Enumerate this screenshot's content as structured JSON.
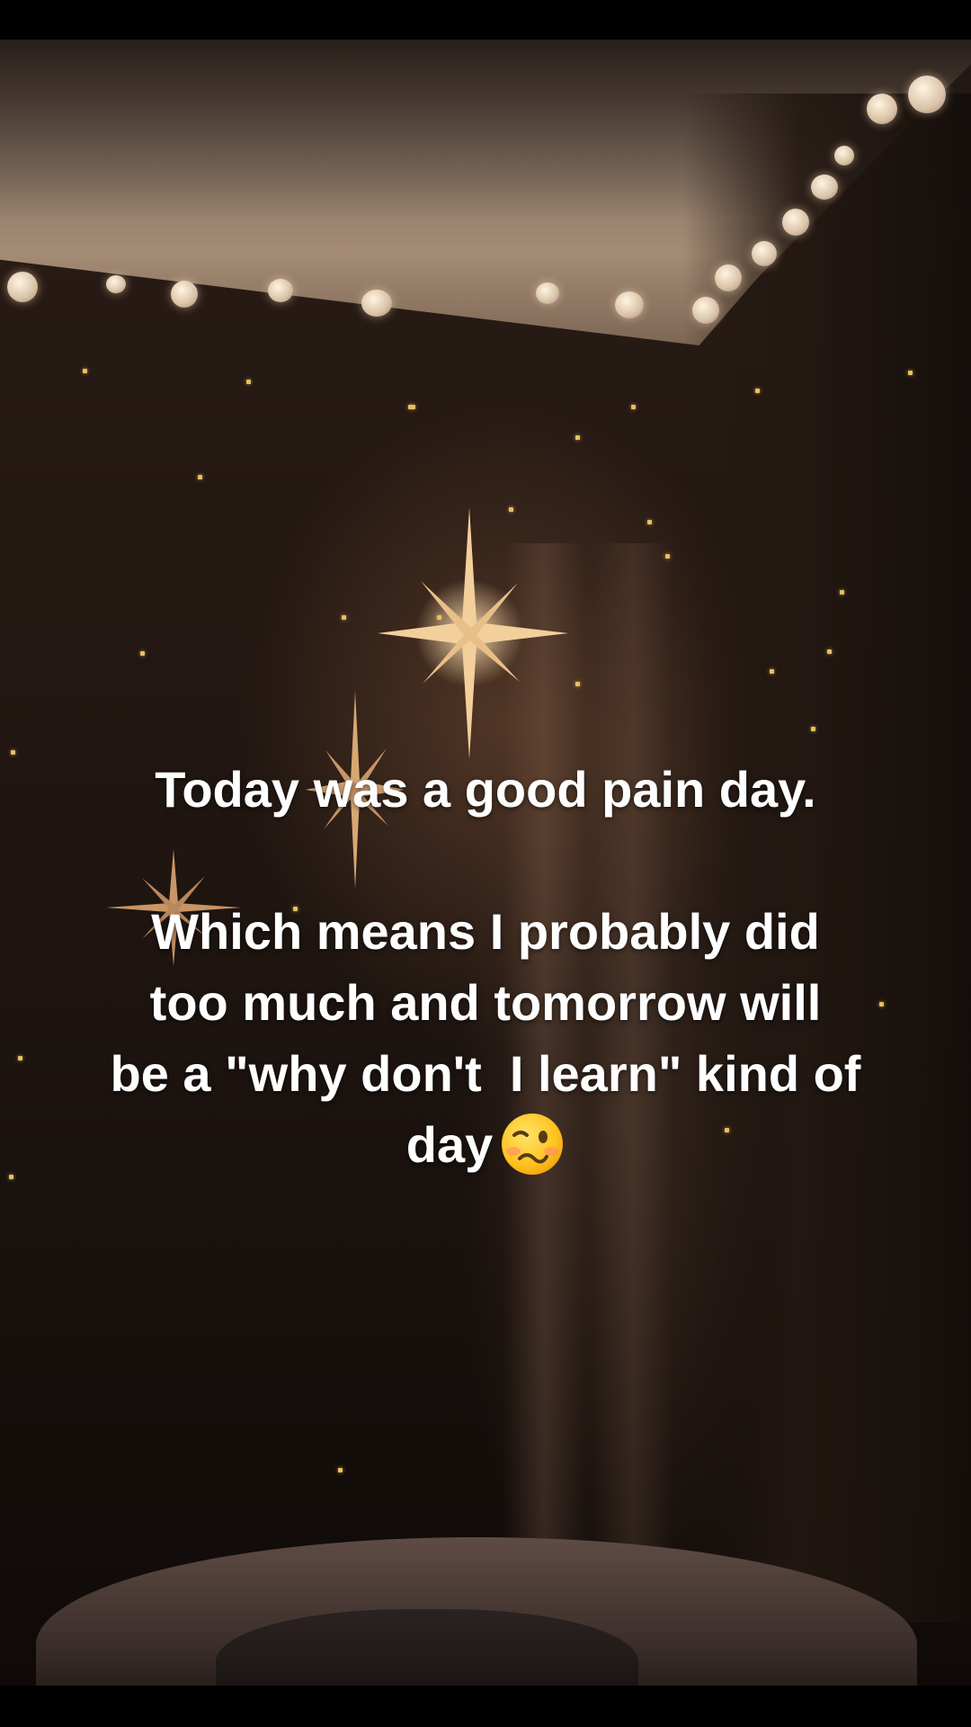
{
  "caption": {
    "line1": "Today was a good pain day.",
    "line2": "Which means I probably did",
    "line3": "too much and tomorrow will",
    "line4": "be a \"why don't  I learn\" kind of",
    "line5": "day"
  },
  "emoji": {
    "icon": "woozy-face-emoji"
  },
  "colors": {
    "text": "#ffffff",
    "star_glow": "#f6d7a8",
    "fairy_lights": "#f1e3cf",
    "specks": "#e8c060",
    "background": "#241812"
  }
}
